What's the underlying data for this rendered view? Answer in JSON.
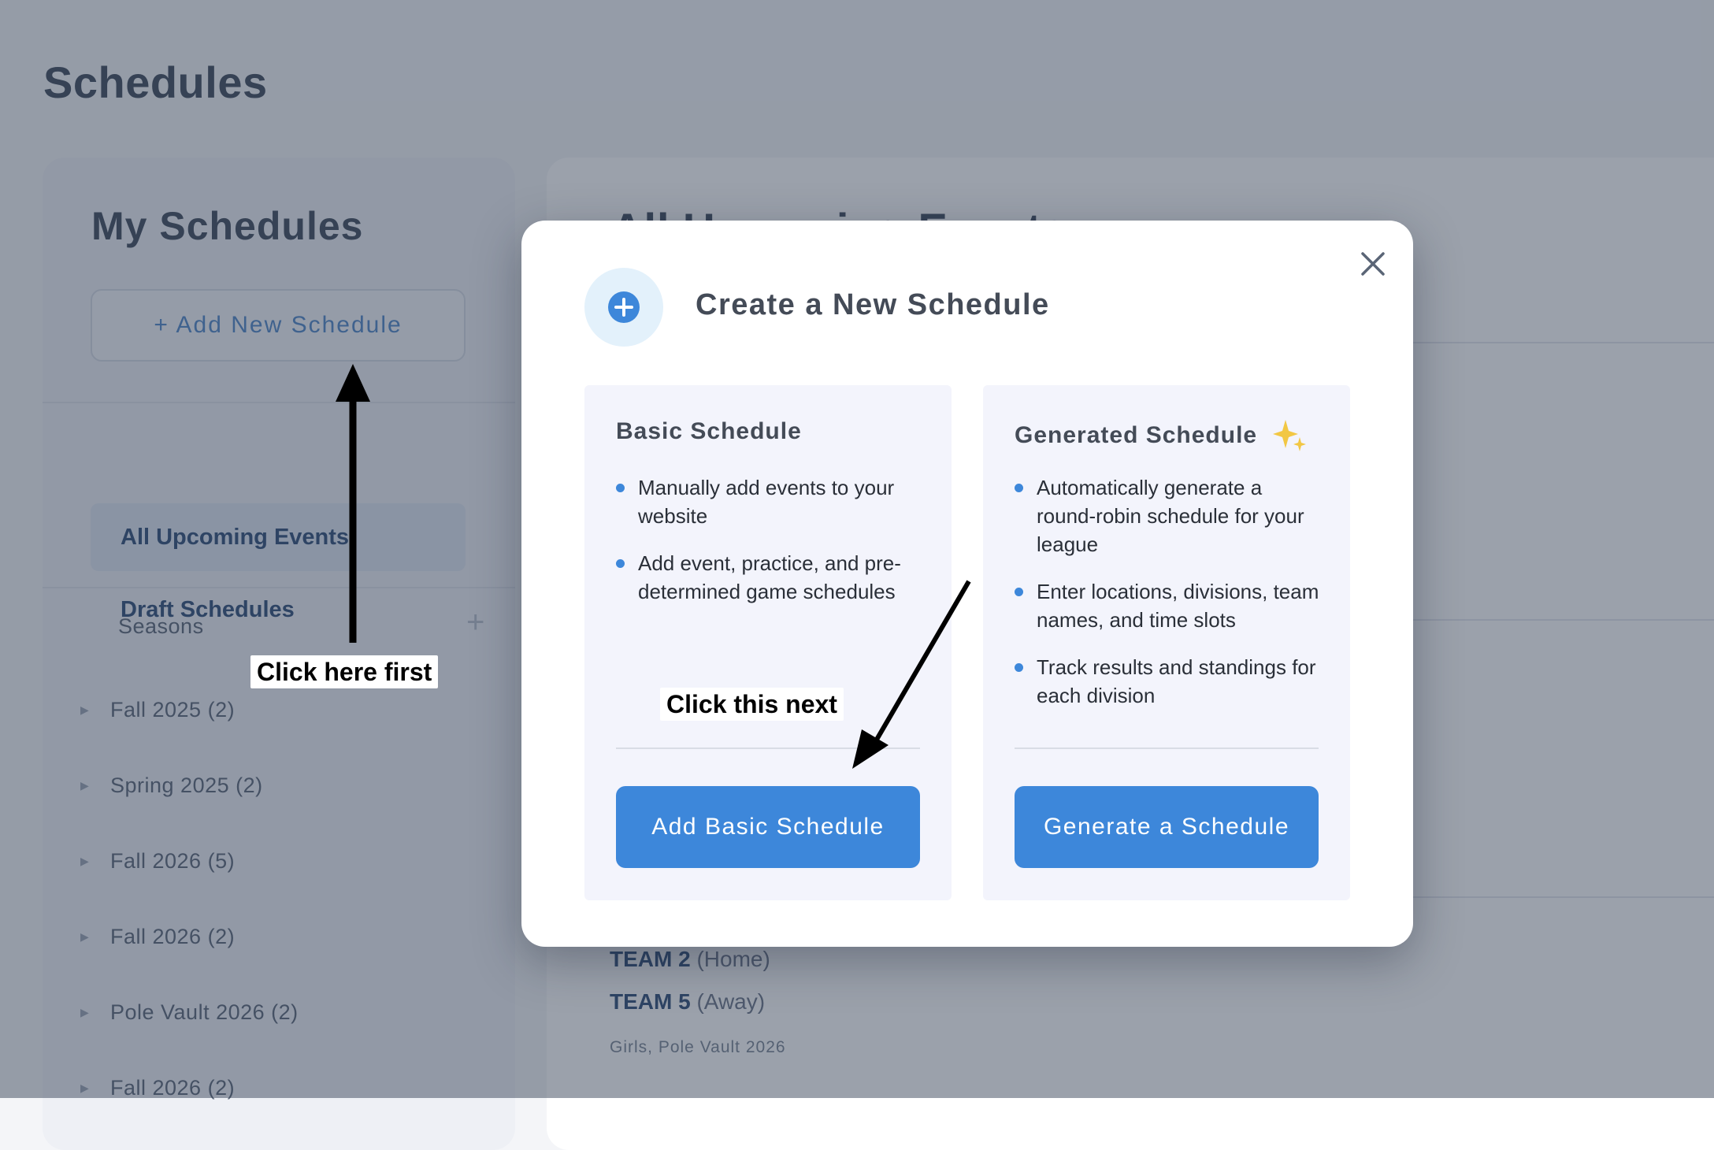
{
  "page": {
    "title": "Schedules"
  },
  "sidebar": {
    "heading": "My Schedules",
    "add_new_label": "+ Add New Schedule",
    "nav_items": [
      {
        "label": "Draft Schedules",
        "active": false
      },
      {
        "label": "All Upcoming Events",
        "active": true
      }
    ],
    "seasons_label": "Seasons",
    "seasons_add": "+",
    "seasons": [
      {
        "label": "Fall 2025 (2)"
      },
      {
        "label": "Spring 2025 (2)"
      },
      {
        "label": "Fall 2026 (5)"
      },
      {
        "label": "Fall 2026 (2)"
      },
      {
        "label": "Pole Vault 2026 (2)"
      },
      {
        "label": "Fall 2026 (2)"
      }
    ]
  },
  "main": {
    "heading": "All Upcoming Events",
    "event": {
      "team_home": "TEAM 2",
      "team_home_role": "(Home)",
      "team_away": "TEAM 5",
      "team_away_role": "(Away)",
      "meta": "Girls, Pole Vault 2026"
    }
  },
  "modal": {
    "title": "Create a New Schedule",
    "icon": "plus-circle-icon",
    "close_icon": "close-icon",
    "cards": [
      {
        "title": "Basic Schedule",
        "bullets": [
          "Manually add events to your website",
          "Add event, practice, and pre-determined game schedules"
        ],
        "button_label": "Add Basic Schedule"
      },
      {
        "title": "Generated Schedule",
        "title_icon": "sparkle-icon",
        "bullets": [
          "Automatically generate a round-robin schedule for your league",
          "Enter locations, divisions, team names, and time slots",
          "Track results and standings for each division"
        ],
        "button_label": "Generate a Schedule"
      }
    ]
  },
  "annotations": {
    "first": "Click here first",
    "next": "Click this next"
  },
  "colors": {
    "accent": "#3d87da",
    "overlay": "rgba(45,58,80,0.48)",
    "sparkle": "#f2c744"
  }
}
